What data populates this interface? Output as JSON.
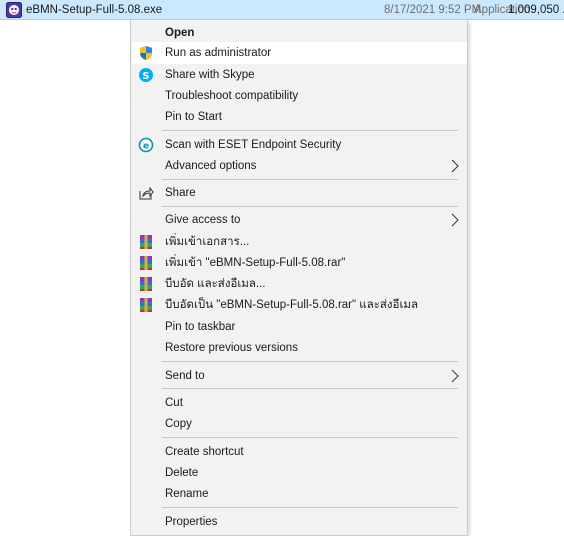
{
  "file_row": {
    "name": "eBMN-Setup-Full-5.08.exe",
    "date": "8/17/2021 9:52 PM",
    "type": "Application",
    "size": "1,009,050 ..."
  },
  "menu": {
    "open": "Open",
    "run_as_admin": "Run as administrator",
    "share_skype": "Share with Skype",
    "troubleshoot": "Troubleshoot compatibility",
    "pin_start": "Pin to Start",
    "scan_eset": "Scan with ESET Endpoint Security",
    "advanced": "Advanced options",
    "share": "Share",
    "give_access": "Give access to",
    "rar_add": "เพิ่มเข้าเอกสาร...",
    "rar_add_named": "เพิ่มเข้า \"eBMN-Setup-Full-5.08.rar\"",
    "rar_compress_email": "บีบอัด และส่งอีเมล...",
    "rar_compress_named_email": "บีบอัดเป็น \"eBMN-Setup-Full-5.08.rar\" และส่งอีเมล",
    "pin_taskbar": "Pin to taskbar",
    "restore": "Restore previous versions",
    "send_to": "Send to",
    "cut": "Cut",
    "copy": "Copy",
    "create_shortcut": "Create shortcut",
    "delete": "Delete",
    "rename": "Rename",
    "properties": "Properties"
  },
  "colors": {
    "selection": "#cce8ff",
    "menu_bg": "#f2f2f2",
    "highlight": "#ffffff",
    "skype": "#00aff0",
    "eset": "#0096a8"
  },
  "icons": {
    "file": "app-exe-icon",
    "run_as_admin": "uac-shield-icon",
    "share_skype": "skype-icon",
    "scan_eset": "eset-icon",
    "share": "share-icon",
    "rar": "winrar-icon",
    "submenu": "chevron-right-icon"
  }
}
